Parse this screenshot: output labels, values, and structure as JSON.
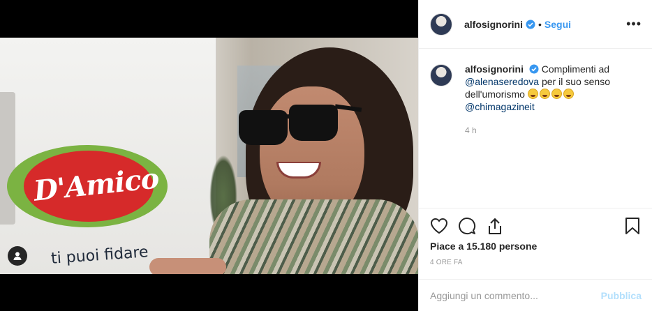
{
  "post": {
    "username": "alfosignorini",
    "follow_label": "Segui",
    "more_label": "•••",
    "image_text": {
      "brand": "D'Amico",
      "tagline": "ti puoi fidare"
    }
  },
  "comment": {
    "username": "alfosignorini",
    "text_start": "Complimenti ad",
    "mention1": "@alenaseredova",
    "text_mid": "per il suo senso dell'umorismo",
    "mention2": "@chimagazineit",
    "time": "4 h"
  },
  "stats": {
    "likes": "Piace a 15.180 persone",
    "ago": "4 ORE FA"
  },
  "input": {
    "placeholder": "Aggiungi un commento...",
    "publish_label": "Pubblica"
  },
  "icons": [
    "heart-icon",
    "comment-icon",
    "share-icon",
    "bookmark-icon",
    "verified-icon",
    "user-tag-icon",
    "more-icon"
  ],
  "colors": {
    "accent": "#3897f0",
    "publish_disabled": "#b2dffc",
    "mention": "#003569"
  }
}
